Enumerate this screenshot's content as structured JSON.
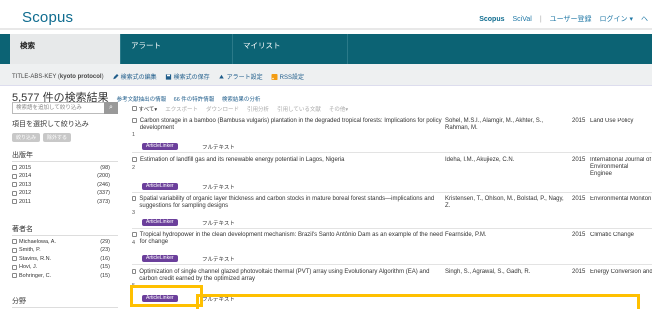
{
  "header": {
    "logo": "Scopus",
    "nav": [
      "Scopus",
      "SciVal",
      "ユーザー登録",
      "ログイン ▾",
      "ヘ"
    ]
  },
  "tabs": [
    "検索",
    "アラート",
    "マイリスト"
  ],
  "query": {
    "prefix": "TITLE-ABS-KEY (",
    "term": "kyoto protocol",
    "suffix": ")",
    "actions": [
      "検索式の編集",
      "検索式の保存",
      "アラート設定",
      "RSS設定"
    ]
  },
  "results_summary": {
    "count": "5,577 件の検索結果",
    "links": [
      "参考文献抽出の情報",
      "66 件の特許情報",
      "検索結果の分析"
    ]
  },
  "refine": {
    "search_placeholder": "検索語を追加して絞り込み",
    "label": "項目を選択して絞り込み",
    "limit_button": "絞り込み",
    "exclude_button": "除外する"
  },
  "facets": {
    "year": {
      "title": "出版年",
      "items": [
        {
          "label": "2015",
          "count": "(98)"
        },
        {
          "label": "2014",
          "count": "(200)"
        },
        {
          "label": "2013",
          "count": "(246)"
        },
        {
          "label": "2012",
          "count": "(337)"
        },
        {
          "label": "2011",
          "count": "(373)"
        }
      ]
    },
    "author": {
      "title": "著者名",
      "items": [
        {
          "label": "Michaelowa, A.",
          "count": "(29)"
        },
        {
          "label": "Smith, P.",
          "count": "(23)"
        },
        {
          "label": "Stavins, R.N.",
          "count": "(16)"
        },
        {
          "label": "Hovi, J.",
          "count": "(15)"
        },
        {
          "label": "Bohringer, C.",
          "count": "(15)"
        }
      ]
    },
    "field": {
      "title": "分野"
    }
  },
  "toolbar": {
    "items": [
      "すべて▾",
      "エクスポート",
      "ダウンロード",
      "引用分析",
      "引用している文献",
      "その他▾"
    ]
  },
  "results": [
    {
      "num": "1",
      "title": "Carbon storage in a bamboo (Bambusa vulgaris) plantation in the degraded tropical forests: Implications for policy development",
      "authors": "Sohel, M.S.I., Alamgir, M., Akhter, S., Rahman, M.",
      "year": "2015",
      "source": "Land Use Policy",
      "badge": "ArticleLinker",
      "full": "フルテキスト"
    },
    {
      "num": "2",
      "title": "Estimation of landfill gas and its renewable energy potential in Lagos, Nigeria",
      "authors": "Ideha, I.M., Akujieze, C.N.",
      "year": "2015",
      "source": "International Journal of Environmental Enginee",
      "badge": "ArticleLinker",
      "full": "フルテキスト"
    },
    {
      "num": "3",
      "title": "Spatial variability of organic layer thickness and carbon stocks in mature boreal forest stands—implications and suggestions for sampling designs",
      "authors": "Kristensen, T., Ohlson, M., Bolstad, P., Nagy, Z.",
      "year": "2015",
      "source": "Environmental Monitori",
      "badge": "ArticleLinker",
      "full": "フルテキスト"
    },
    {
      "num": "4",
      "title": "Tropical hydropower in the clean development mechanism: Brazil's Santo Antônio Dam as an example of the need for change",
      "authors": "Fearnside, P.M.",
      "year": "2015",
      "source": "Climatic Change",
      "badge": "ArticleLinker",
      "full": "フルテキスト"
    },
    {
      "num": "5",
      "title": "Optimization of single channel glazed photovoltaic thermal (PVT) array using Evolutionary Algorithm (EA) and carbon credit earned by the optimized array",
      "authors": "Singh, S., Agrawal, S., Gadh, R.",
      "year": "2015",
      "source": "Energy Conversion and",
      "badge": "ArticleLinker",
      "full": "フルテキスト"
    }
  ],
  "colors": {
    "brand": "#0f6c8f",
    "tabbar": "#0c6374",
    "badge": "#6b3f9b",
    "highlight": "#ffc000"
  }
}
